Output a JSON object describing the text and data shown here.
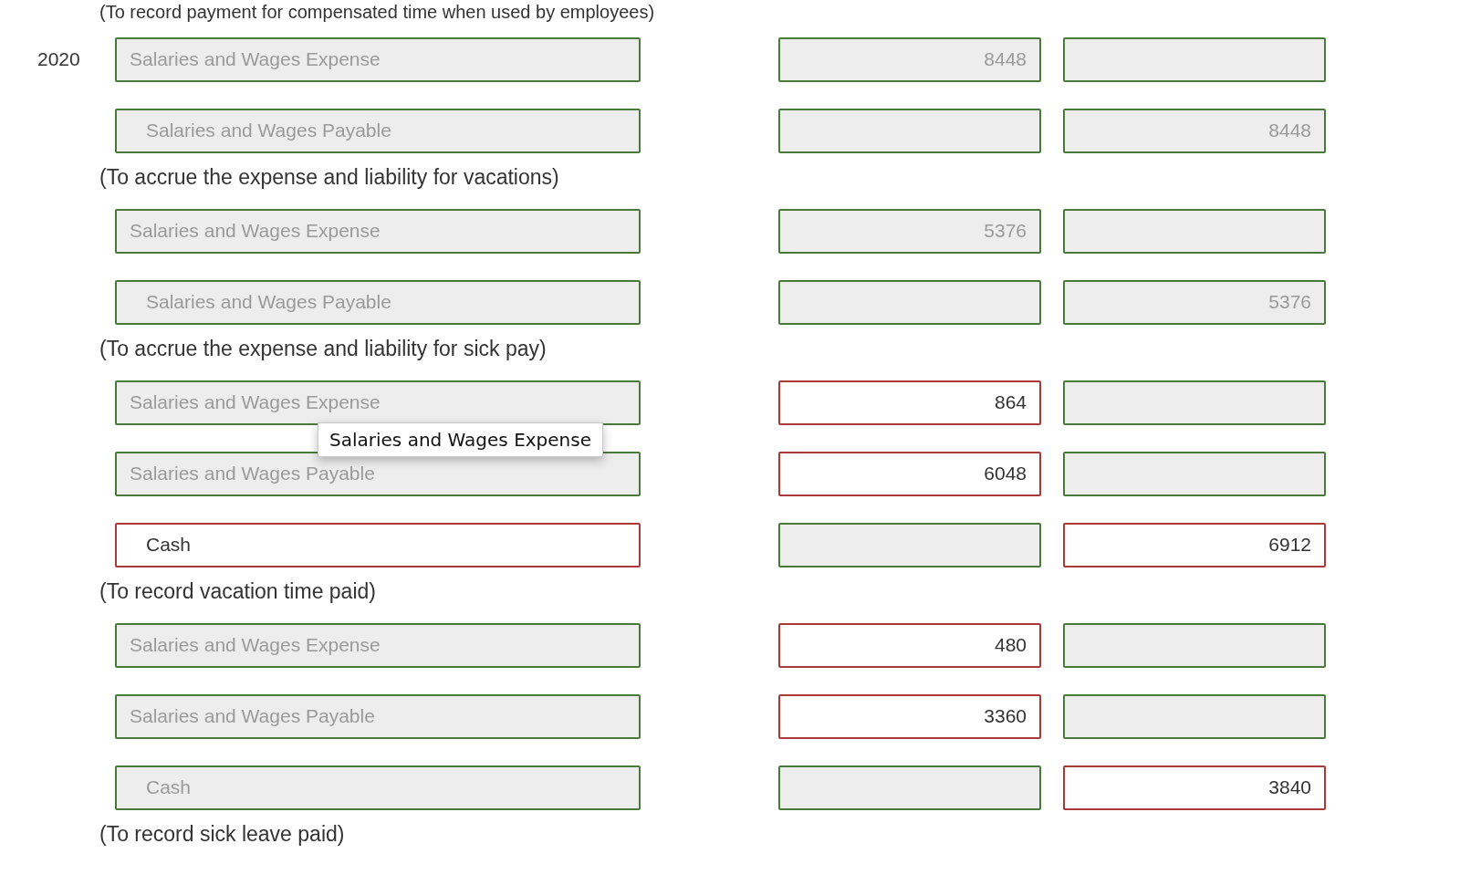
{
  "heading": "(To record payment for compensated time when used by employees)",
  "entries": [
    {
      "date": "2020",
      "lines": [
        {
          "account": "Salaries and Wages Expense",
          "account_correct": true,
          "indent": false,
          "debit": "8448",
          "debit_correct": true,
          "credit_correct": true
        },
        {
          "account": "Salaries and Wages Payable",
          "account_correct": true,
          "indent": true,
          "debit_correct": true,
          "credit": "8448",
          "credit_correct": true
        }
      ],
      "explanation": "(To accrue the expense and liability for vacations)"
    },
    {
      "lines": [
        {
          "account": "Salaries and Wages Expense",
          "account_correct": true,
          "indent": false,
          "debit": "5376",
          "debit_correct": true,
          "credit_correct": true
        },
        {
          "account": "Salaries and Wages Payable",
          "account_correct": true,
          "indent": true,
          "debit_correct": true,
          "credit": "5376",
          "credit_correct": true
        }
      ],
      "explanation": "(To accrue the expense and liability for sick pay)"
    },
    {
      "lines": [
        {
          "account": "Salaries and Wages Expense",
          "account_correct": true,
          "indent": false,
          "debit": "864",
          "debit_correct": false,
          "credit_correct": true,
          "tooltip": "Salaries and Wages Expense"
        },
        {
          "account": "Salaries and Wages Payable",
          "account_correct": true,
          "indent": false,
          "debit": "6048",
          "debit_correct": false,
          "credit_correct": true
        },
        {
          "account": "Cash",
          "account_correct": false,
          "indent": true,
          "debit_correct": true,
          "credit": "6912",
          "credit_correct": false
        }
      ],
      "explanation": "(To record vacation time paid)"
    },
    {
      "lines": [
        {
          "account": "Salaries and Wages Expense",
          "account_correct": true,
          "indent": false,
          "debit": "480",
          "debit_correct": false,
          "credit_correct": true
        },
        {
          "account": "Salaries and Wages Payable",
          "account_correct": true,
          "indent": false,
          "debit": "3360",
          "debit_correct": false,
          "credit_correct": true
        },
        {
          "account": "Cash",
          "account_correct": true,
          "indent": true,
          "debit_correct": true,
          "credit": "3840",
          "credit_correct": false
        }
      ],
      "explanation": "(To record sick leave paid)"
    }
  ]
}
